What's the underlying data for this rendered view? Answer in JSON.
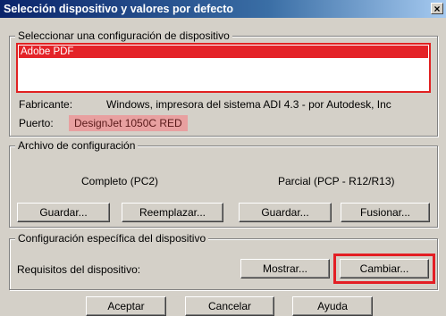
{
  "window": {
    "title": "Selección dispositivo y valores por defecto",
    "close_glyph": "×"
  },
  "device_group": {
    "legend": "Seleccionar una configuración de dispositivo",
    "items": [
      "Adobe PDF"
    ],
    "manufacturer_label": "Fabricante:",
    "manufacturer_value": "Windows, impresora del sistema ADI 4.3 - por Autodesk, Inc",
    "port_label": "Puerto:",
    "port_value": "DesignJet 1050C RED"
  },
  "config_group": {
    "legend": "Archivo de configuración",
    "complete_label": "Completo (PC2)",
    "partial_label": "Parcial (PCP - R12/R13)",
    "buttons": {
      "save_complete": "Guardar...",
      "replace": "Reemplazar...",
      "save_partial": "Guardar...",
      "merge": "Fusionar..."
    }
  },
  "specific_group": {
    "legend": "Configuración específica del dispositivo",
    "requirements_label": "Requisitos del dispositivo:",
    "buttons": {
      "show": "Mostrar...",
      "change": "Cambiar..."
    }
  },
  "footer": {
    "ok": "Aceptar",
    "cancel": "Cancelar",
    "help": "Ayuda"
  },
  "colors": {
    "highlight": "#e31e24",
    "selection": "#e42328"
  }
}
